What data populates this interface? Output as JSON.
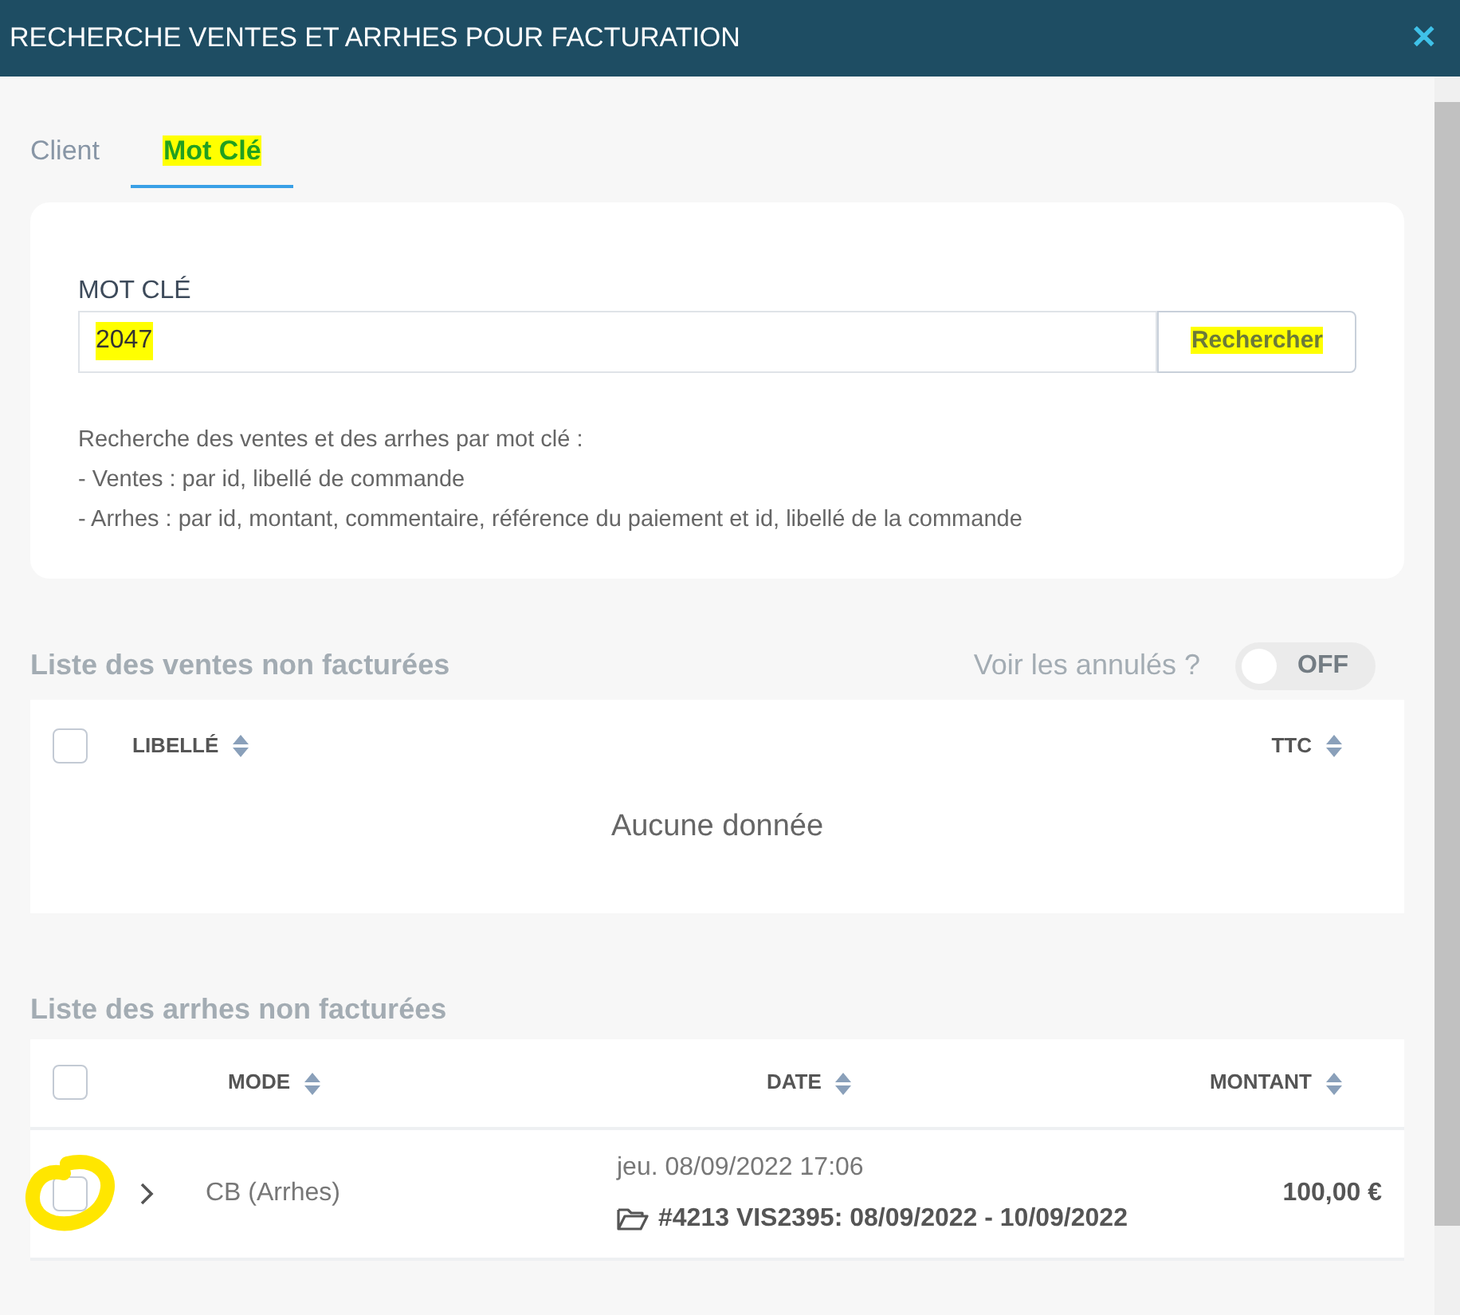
{
  "window": {
    "title": "RECHERCHE VENTES ET ARRHES POUR FACTURATION",
    "close": "✕"
  },
  "tabs": [
    {
      "label": "Client",
      "selected": false,
      "highlighted": false
    },
    {
      "label": "Mot Clé",
      "selected": true,
      "highlighted": true
    }
  ],
  "search": {
    "label": "MOT CLÉ",
    "value": "2047",
    "value_highlighted": true,
    "button": "Rechercher",
    "button_highlighted": true,
    "help": [
      "Recherche des ventes et des arrhes par mot clé :",
      "- Ventes : par id, libellé de commande",
      "- Arrhes : par id, montant, commentaire, référence du paiement et id, libellé de la commande"
    ]
  },
  "sales": {
    "title": "Liste des ventes non facturées",
    "toggle_label": "Voir les annulés ?",
    "toggle": {
      "on": false,
      "text": "OFF"
    },
    "columns": [
      "LIBELLÉ",
      "TTC"
    ],
    "all_checked": false,
    "empty": "Aucune donnée"
  },
  "deposits": {
    "title": "Liste des arrhes non facturées",
    "columns": [
      "MODE",
      "DATE",
      "MONTANT"
    ],
    "all_checked": false,
    "rows": [
      {
        "checked": false,
        "circled": true,
        "mode": "CB (Arrhes)",
        "date": "jeu. 08/09/2022 17:06",
        "order": "#4213 VIS2395: 08/09/2022 - 10/09/2022",
        "amount": "100,00 €"
      }
    ]
  }
}
